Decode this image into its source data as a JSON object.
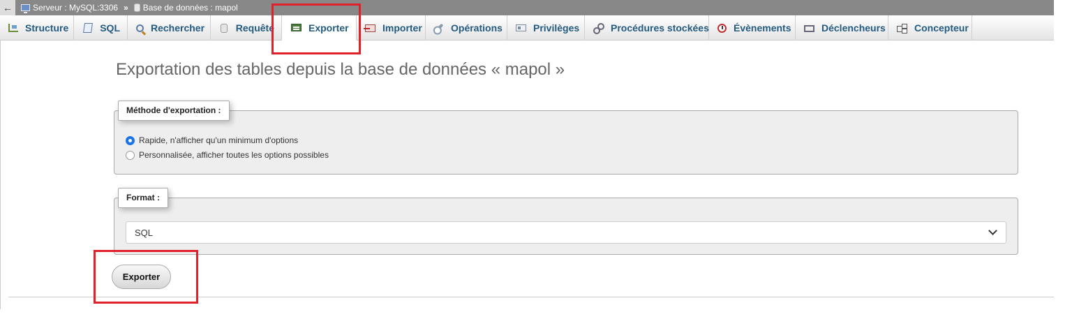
{
  "breadcrumb": {
    "back_glyph": "←",
    "server": "Serveur : MySQL:3306",
    "separator": "»",
    "database": "Base de données : mapol"
  },
  "tabs": [
    {
      "label": "Structure",
      "icon": "structure-icon"
    },
    {
      "label": "SQL",
      "icon": "sql-icon"
    },
    {
      "label": "Rechercher",
      "icon": "search-icon"
    },
    {
      "label": "Requête",
      "icon": "query-icon"
    },
    {
      "label": "Exporter",
      "icon": "export-icon",
      "active": true
    },
    {
      "label": "Importer",
      "icon": "import-icon"
    },
    {
      "label": "Opérations",
      "icon": "wrench-icon"
    },
    {
      "label": "Privilèges",
      "icon": "privileges-icon"
    },
    {
      "label": "Procédures stockées",
      "icon": "routines-icon"
    },
    {
      "label": "Évènements",
      "icon": "clock-icon"
    },
    {
      "label": "Déclencheurs",
      "icon": "triggers-icon"
    },
    {
      "label": "Concepteur",
      "icon": "designer-icon"
    }
  ],
  "main": {
    "title": "Exportation des tables depuis la base de données « mapol »",
    "method": {
      "legend": "Méthode d'exportation :",
      "options": [
        {
          "label": "Rapide, n'afficher qu'un minimum d'options",
          "checked": true
        },
        {
          "label": "Personnalisée, afficher toutes les options possibles",
          "checked": false
        }
      ]
    },
    "format": {
      "legend": "Format :",
      "selected": "SQL"
    },
    "submit_label": "Exporter"
  },
  "colors": {
    "tab_text": "#235a81",
    "annotation": "#e0202a",
    "radio_checked": "#1a73e8"
  }
}
